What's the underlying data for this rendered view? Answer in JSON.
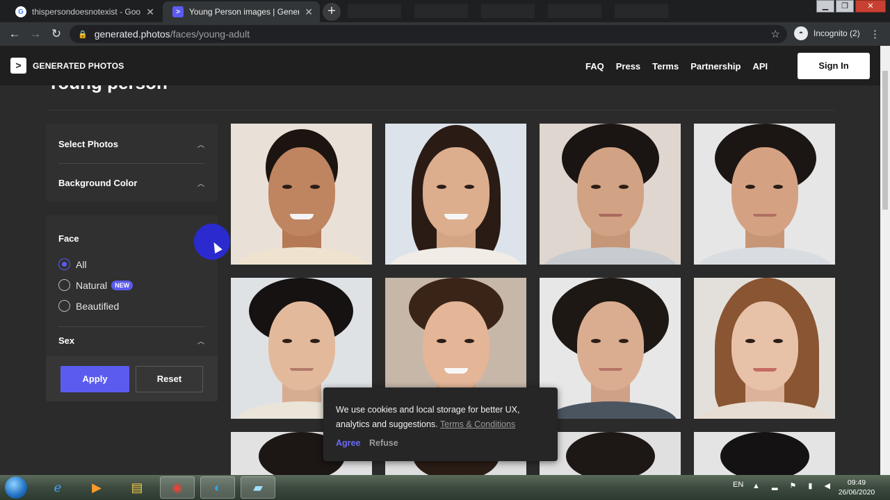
{
  "browser": {
    "tabs": [
      {
        "title": "thispersondoesnotexist - Google",
        "favicon": "google-icon",
        "active": false
      },
      {
        "title": "Young Person images | Generate",
        "favicon": "generated-photos-icon",
        "active": true
      }
    ],
    "new_tab": "+",
    "address": {
      "host": "generated.photos",
      "path": "/faces/young-adult"
    },
    "incognito_label": "Incognito (2)",
    "window_controls": {
      "minimize": "▁",
      "maximize": "❐",
      "close": "✕"
    }
  },
  "site": {
    "logo_mark": ">",
    "logo_text": "GENERATED PHOTOS",
    "nav": [
      "FAQ",
      "Press",
      "Terms",
      "Partnership",
      "API"
    ],
    "sign_in": "Sign In",
    "heading": "Young person"
  },
  "filters": {
    "sections": {
      "select_photos": "Select Photos",
      "background_color": "Background Color",
      "face": "Face",
      "sex": "Sex"
    },
    "face_options": [
      {
        "label": "All",
        "selected": true
      },
      {
        "label": "Natural",
        "badge": "NEW",
        "selected": false
      },
      {
        "label": "Beautified",
        "selected": false
      }
    ],
    "apply": "Apply",
    "reset": "Reset"
  },
  "cookie": {
    "message": "We use cookies and local storage for better UX, analytics and suggestions.",
    "link": "Terms & Conditions",
    "agree": "Agree",
    "refuse": "Refuse"
  },
  "taskbar": {
    "language": "EN",
    "time": "09:49",
    "date": "26/06/2020"
  },
  "colors": {
    "accent": "#5b5bf0",
    "page_bg": "#2b2b2b",
    "panel_bg": "#303030",
    "header_bg": "#1f1f1f"
  }
}
